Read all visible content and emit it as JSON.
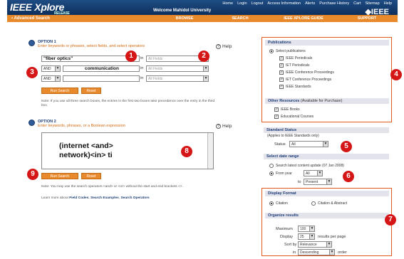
{
  "header": {
    "logo": "IEEE Xplore",
    "logo_sub": "RELEASE 2.4",
    "welcome": "Welcome Mahidol University",
    "brand": "IEEE",
    "links": [
      "Home",
      "Login",
      "Logout",
      "Access Information",
      "Alerts",
      "Purchase History",
      "Cart",
      "Sitemap",
      "Help"
    ]
  },
  "nav": {
    "title": "Advanced Search",
    "tabs": [
      "BROWSE",
      "SEARCH",
      "IEEE XPLORE GUIDE",
      "SUPPORT"
    ]
  },
  "option1": {
    "label": "OPTION 1",
    "subtitle": "Enter keywords or phrases, select fields, and select operators",
    "help": "Help",
    "rows": [
      {
        "operator": "",
        "term": "\"fiber optics\"",
        "in": "in",
        "field": "All Fields"
      },
      {
        "operator": "AND",
        "term": "communication",
        "in": "in",
        "field": "All Fields"
      },
      {
        "operator": "AND",
        "term": "",
        "in": "in",
        "field": "All Fields"
      }
    ],
    "run": "Run Search",
    "reset": "Reset",
    "note": "Note: If you use all three search boxes, the entries in the first two boxes take precedence over the entry in the third box."
  },
  "option2": {
    "label": "OPTION 2",
    "subtitle": "Enter keywords, phrases, or a Boolean expression",
    "help": "Help",
    "query_line1": "(internet <and>",
    "query_line2": "network)<in> ti",
    "run": "Run Search",
    "reset": "Reset",
    "note1": "Note: You may use the search operators <and> or <or> without the start and end brackets <>.",
    "note2_pre": "Learn more about ",
    "note2_l1": "Field Codes",
    "note2_l2": "Search Examples",
    "note2_l3": "Search Operators"
  },
  "markers": [
    "1",
    "2",
    "3",
    "4",
    "5",
    "6",
    "7",
    "8",
    "9"
  ],
  "publications": {
    "title": "Publications",
    "select": "Select publications",
    "items": [
      "IEEE Periodicals",
      "IET Periodicals",
      "IEEE Conference Proceedings",
      "IET Conference Proceedings",
      "IEEE Standards"
    ]
  },
  "other": {
    "title": "Other Resources",
    "title_note": "(Available for Purchase)",
    "items": [
      "IEEE Books",
      "Educational Courses"
    ]
  },
  "standard": {
    "title": "Standard Status",
    "sub": "(Applies to IEEE Standards only)",
    "status_label": "Status",
    "status_value": "All"
  },
  "date": {
    "title": "Select date range",
    "opt1": "Search latest content update (07 Jan 2008)",
    "opt2": "From year",
    "from_value": "All",
    "to_label": "to",
    "to_value": "Present"
  },
  "display": {
    "title": "Display Format",
    "citation": "Citation",
    "citation_abstract": "Citation & Abstract"
  },
  "organize": {
    "title": "Organize results",
    "max_label": "Maximum",
    "max_value": "100",
    "disp_label": "Display",
    "disp_value": "25",
    "disp_suffix": "results per page",
    "sort_label": "Sort by",
    "sort_value": "Relevance",
    "in_label": "in",
    "order_value": "Descending",
    "order_suffix": "order"
  }
}
